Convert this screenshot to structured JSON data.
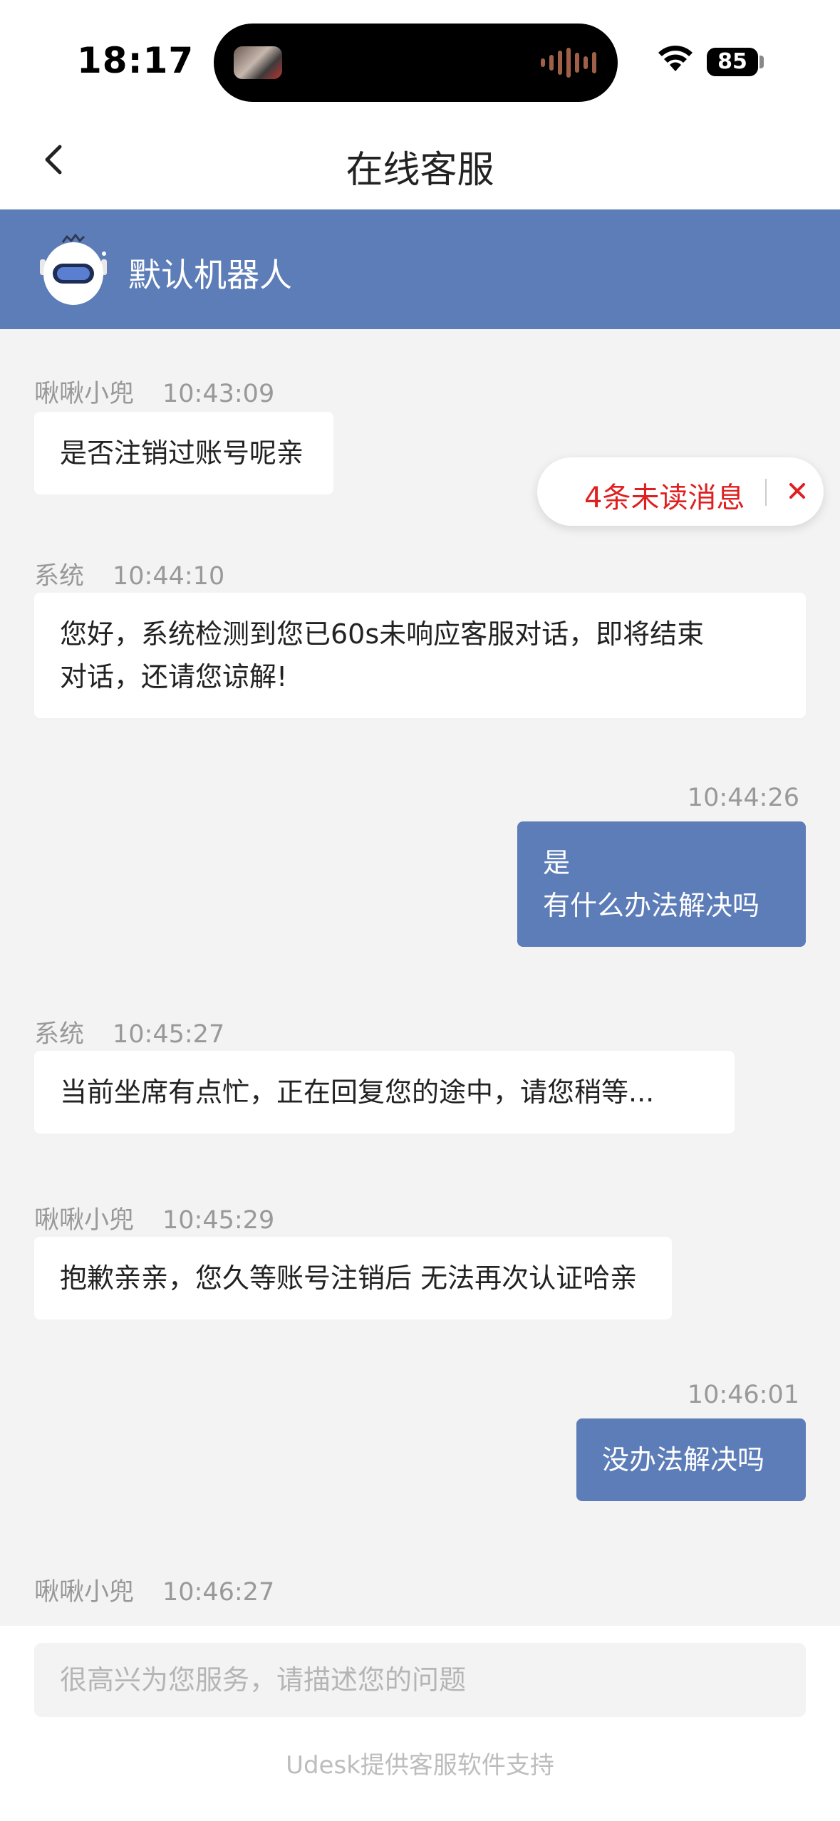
{
  "status_bar": {
    "time": "18:17",
    "battery": "85"
  },
  "nav": {
    "title": "在线客服"
  },
  "agent": {
    "name": "默认机器人"
  },
  "messages": [
    {
      "sender": "啾啾小兜",
      "time": "10:43:09",
      "text": "是否注销过账号呢亲"
    },
    {
      "sender": "系统",
      "time": "10:44:10",
      "text": "您好，系统检测到您已60s未响应客服对话，即将结束\n对话，还请您谅解!"
    },
    {
      "sender": "",
      "time": "10:44:26",
      "text": "是\n有什么办法解决吗"
    },
    {
      "sender": "系统",
      "time": "10:45:27",
      "text": "当前坐席有点忙，正在回复您的途中，请您稍等..."
    },
    {
      "sender": "啾啾小兜",
      "time": "10:45:29",
      "text": "抱歉亲亲，您久等账号注销后 无法再次认证哈亲"
    },
    {
      "sender": "",
      "time": "10:46:01",
      "text": "没办法解决吗"
    },
    {
      "sender": "啾啾小兜",
      "time": "10:46:27",
      "text": ""
    }
  ],
  "unread": {
    "label": "4条未读消息"
  },
  "input": {
    "placeholder": "很高兴为您服务，请描述您的问题",
    "value": ""
  },
  "footer": {
    "powered_by": "Udesk提供客服软件支持"
  },
  "colors": {
    "accent": "#5d7db8",
    "unread": "#e02020",
    "background": "#f3f3f3"
  },
  "icons": {
    "back": "chevron-left-icon",
    "close": "close-icon",
    "avatar": "robot-icon"
  }
}
